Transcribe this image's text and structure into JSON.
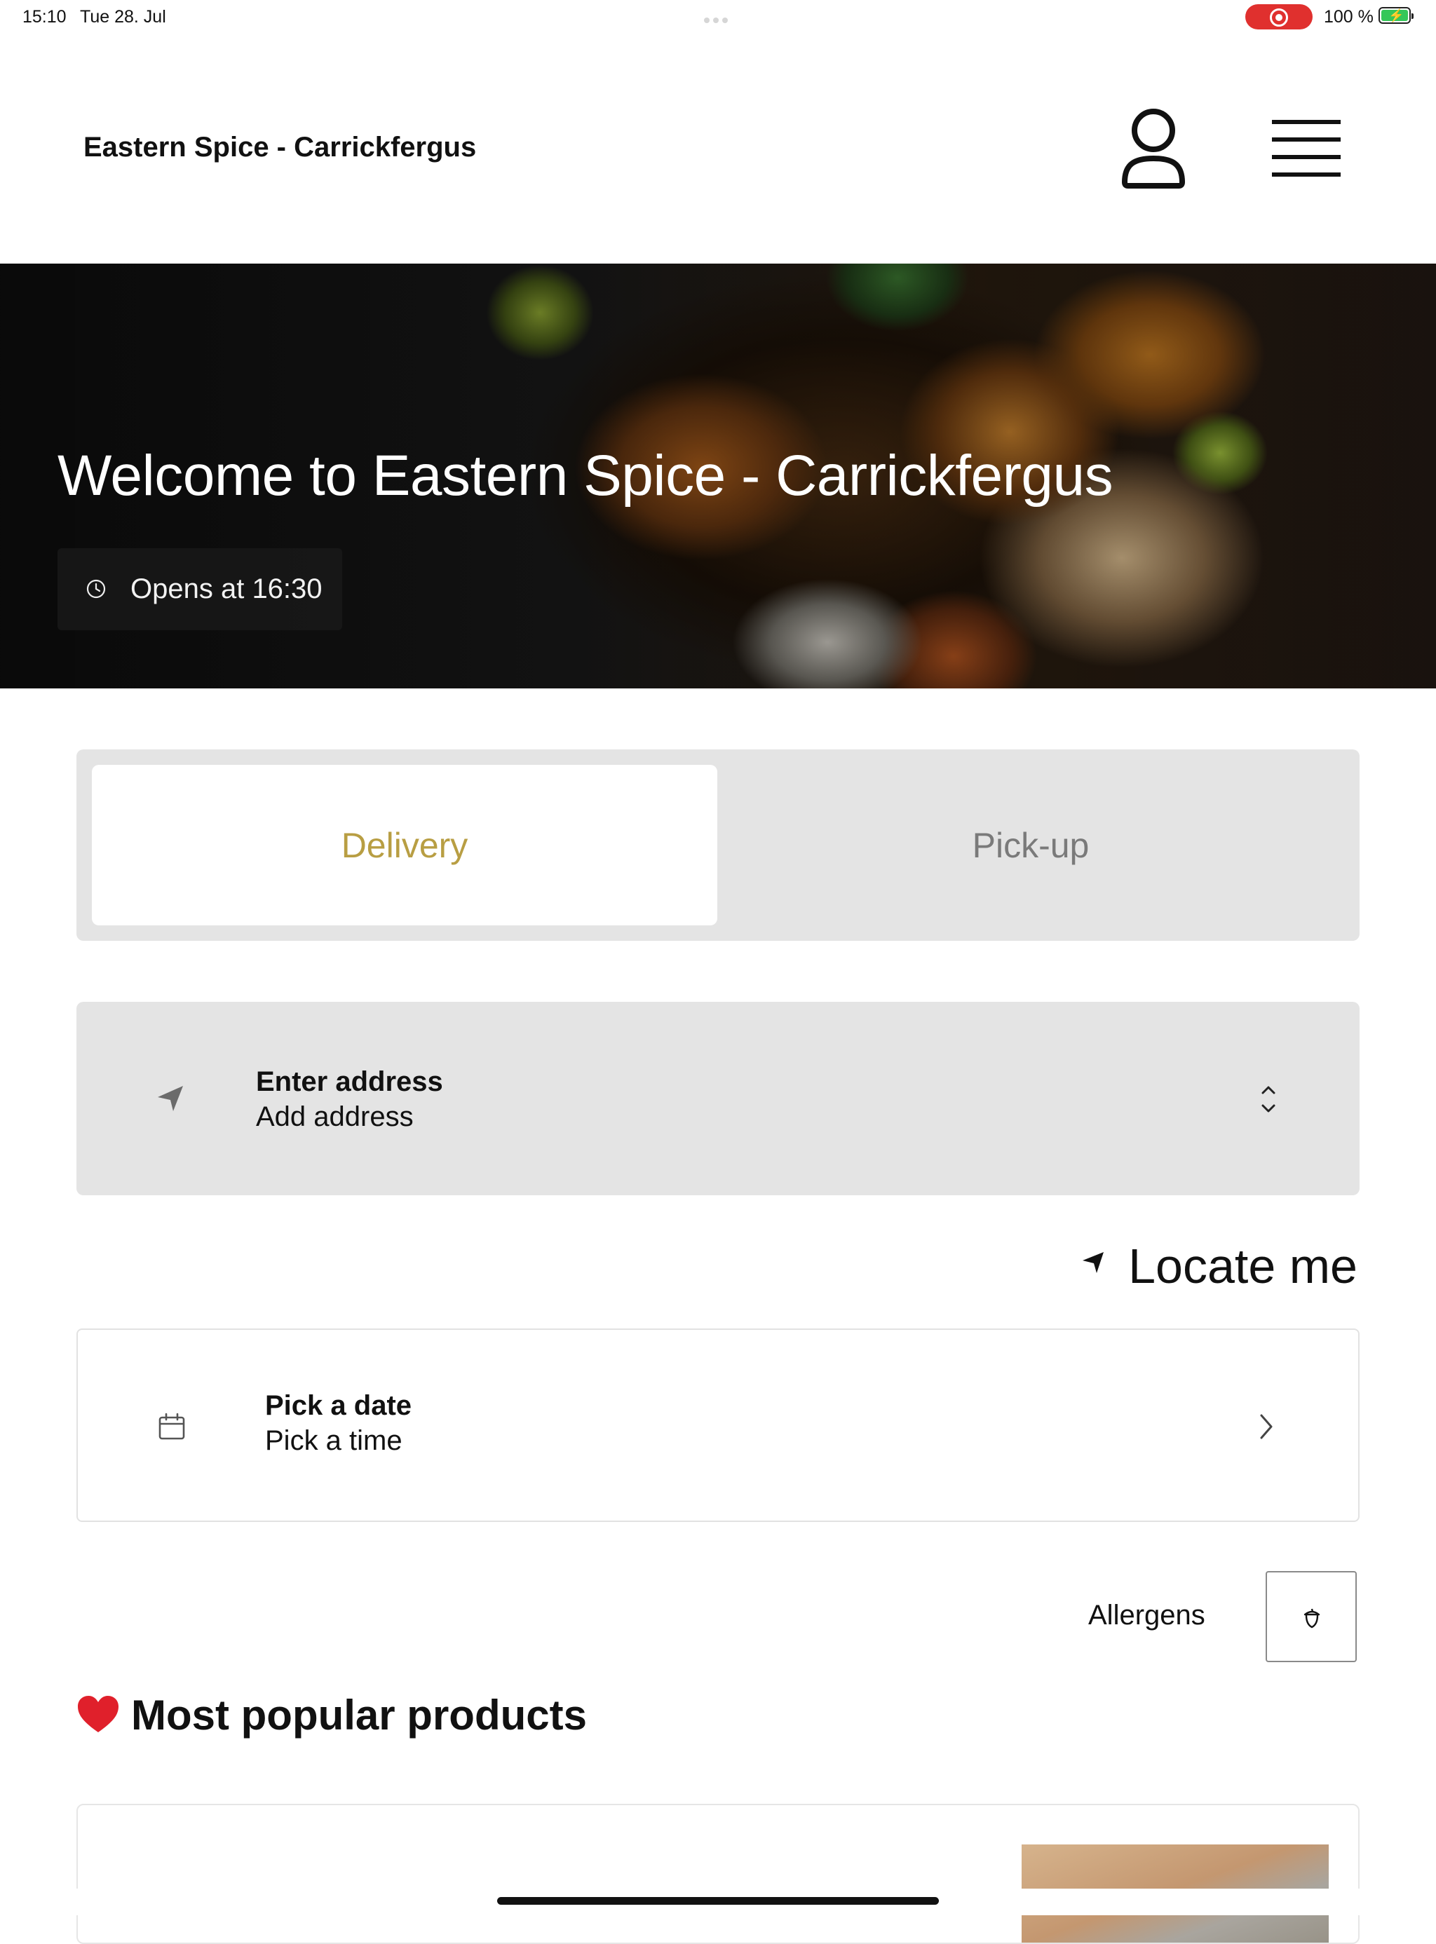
{
  "status_bar": {
    "time": "15:10",
    "date": "Tue 28. Jul",
    "battery_text": "100 %"
  },
  "header": {
    "title": "Eastern Spice - Carrickfergus"
  },
  "hero": {
    "title": "Welcome to Eastern Spice - Carrickfergus",
    "opens_text": "Opens at 16:30"
  },
  "order_mode": {
    "delivery_label": "Delivery",
    "pickup_label": "Pick-up",
    "selected": "Delivery",
    "selected_color": "#b89e43"
  },
  "address": {
    "title": "Enter address",
    "subtitle": "Add address"
  },
  "locate": {
    "label": "Locate me"
  },
  "schedule": {
    "title": "Pick a date",
    "subtitle": "Pick a time"
  },
  "allergens": {
    "label": "Allergens"
  },
  "popular": {
    "title": "Most popular products"
  },
  "icons": [
    "user-icon",
    "menu-icon",
    "clock-icon",
    "location-arrow-icon",
    "chevron-up-down-icon",
    "calendar-icon",
    "chevron-right-icon",
    "acorn-icon",
    "heart-icon"
  ]
}
